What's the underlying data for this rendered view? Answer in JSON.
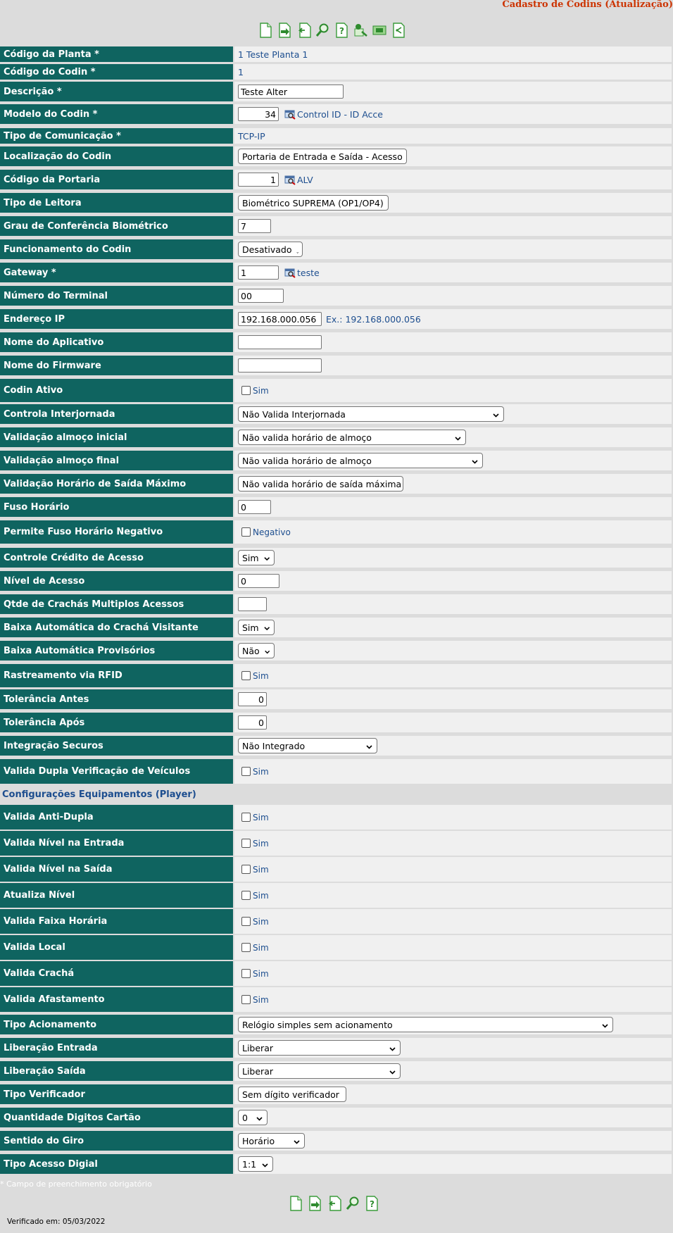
{
  "page": {
    "title": "Cadastro de Codins (Atualização)"
  },
  "toolbar": [
    "new-document-icon",
    "save-document-icon",
    "undo-document-icon",
    "search-icon",
    "help-icon",
    "tools-icon",
    "equipment-icon",
    "share-icon"
  ],
  "toolbar_bottom": [
    "new-document-icon",
    "save-document-icon",
    "undo-document-icon",
    "search-icon",
    "help-icon"
  ],
  "fields": {
    "codigo_planta": {
      "label": "Código da Planta *",
      "value": "1 Teste Planta 1"
    },
    "codigo_codin": {
      "label": "Código do Codin *",
      "value": "1"
    },
    "descricao": {
      "label": "Descrição *",
      "value": "Teste Alter"
    },
    "modelo_codin": {
      "label": "Modelo do Codin *",
      "value": "34",
      "lookup_text": "Control ID - ID Acce"
    },
    "tipo_comunicacao": {
      "label": "Tipo de Comunicação *",
      "value": "TCP-IP"
    },
    "localizacao": {
      "label": "Localização do Codin",
      "value": "Portaria de Entrada e Saída - Acesso"
    },
    "codigo_portaria": {
      "label": "Código da Portaria",
      "value": "1",
      "lookup_text": "ALV"
    },
    "tipo_leitora": {
      "label": "Tipo de Leitora",
      "value": "Biométrico SUPREMA (OP1/OP4)"
    },
    "grau_biometrico": {
      "label": "Grau de Conferência Biométrico",
      "value": "7"
    },
    "funcionamento": {
      "label": "Funcionamento do Codin",
      "value": "Desativado"
    },
    "gateway": {
      "label": "Gateway *",
      "value": "1",
      "lookup_text": "teste"
    },
    "numero_terminal": {
      "label": "Número do Terminal",
      "value": "00"
    },
    "endereco_ip": {
      "label": "Endereço IP",
      "value": "192.168.000.056",
      "hint": "Ex.: 192.168.000.056"
    },
    "nome_aplicativo": {
      "label": "Nome do Aplicativo",
      "value": ""
    },
    "nome_firmware": {
      "label": "Nome do Firmware",
      "value": ""
    },
    "codin_ativo": {
      "label": "Codin Ativo",
      "option": "Sim"
    },
    "interjornada": {
      "label": "Controla Interjornada",
      "value": "Não Valida Interjornada"
    },
    "almoco_inicial": {
      "label": "Validação almoço inicial",
      "value": "Não valida horário de almoço"
    },
    "almoco_final": {
      "label": "Validação almoço final",
      "value": "Não valida horário de almoço"
    },
    "saida_maximo": {
      "label": "Validação Horário de Saída Máximo",
      "value": "Não valida horário de saída máxima"
    },
    "fuso_horario": {
      "label": "Fuso Horário",
      "value": "0"
    },
    "fuso_negativo": {
      "label": "Permite Fuso Horário Negativo",
      "option": "Negativo"
    },
    "credito_acesso": {
      "label": "Controle Crédito de Acesso",
      "value": "Sim"
    },
    "nivel_acesso": {
      "label": "Nível de Acesso",
      "value": "0"
    },
    "qtde_crachas": {
      "label": "Qtde de Crachás Multiplos Acessos",
      "value": ""
    },
    "baixa_visitante": {
      "label": "Baixa Automática do Crachá Visitante",
      "value": "Sim"
    },
    "baixa_provisorios": {
      "label": "Baixa Automática Provisórios",
      "value": "Não"
    },
    "rastreamento_rfid": {
      "label": "Rastreamento via RFID",
      "option": "Sim"
    },
    "tolerancia_antes": {
      "label": "Tolerância Antes",
      "value": "0"
    },
    "tolerancia_apos": {
      "label": "Tolerância Após",
      "value": "0"
    },
    "integracao_securos": {
      "label": "Integração Securos",
      "value": "Não Integrado"
    },
    "dupla_veiculos": {
      "label": "Valida Dupla Verificação de Veículos",
      "option": "Sim"
    }
  },
  "player_section": {
    "title": "Configurações Equipamentos (Player)",
    "anti_dupla": {
      "label": "Valida Anti-Dupla",
      "option": "Sim"
    },
    "nivel_entrada": {
      "label": "Valida Nível na Entrada",
      "option": "Sim"
    },
    "nivel_saida": {
      "label": "Valida Nível na Saída",
      "option": "Sim"
    },
    "atualiza_nivel": {
      "label": "Atualiza Nível",
      "option": "Sim"
    },
    "faixa_horaria": {
      "label": "Valida Faixa Horária",
      "option": "Sim"
    },
    "valida_local": {
      "label": "Valida Local",
      "option": "Sim"
    },
    "valida_cracha": {
      "label": "Valida Crachá",
      "option": "Sim"
    },
    "valida_afastamento": {
      "label": "Valida Afastamento",
      "option": "Sim"
    },
    "tipo_acionamento": {
      "label": "Tipo Acionamento",
      "value": "Relógio simples sem acionamento"
    },
    "liberacao_entrada": {
      "label": "Liberação Entrada",
      "value": "Liberar"
    },
    "liberacao_saida": {
      "label": "Liberação Saída",
      "value": "Liberar"
    },
    "tipo_verificador": {
      "label": "Tipo Verificador",
      "value": "Sem dígito verificador"
    },
    "qtd_digitos": {
      "label": "Quantidade Digitos Cartão",
      "value": "0"
    },
    "sentido_giro": {
      "label": "Sentido do Giro",
      "value": "Horário"
    },
    "tipo_digital": {
      "label": "Tipo Acesso Digial",
      "value": "1:1"
    }
  },
  "footer": {
    "required_note": "* Campo de preenchimento obrigatório",
    "verified": "Verificado em: 05/03/2022"
  }
}
